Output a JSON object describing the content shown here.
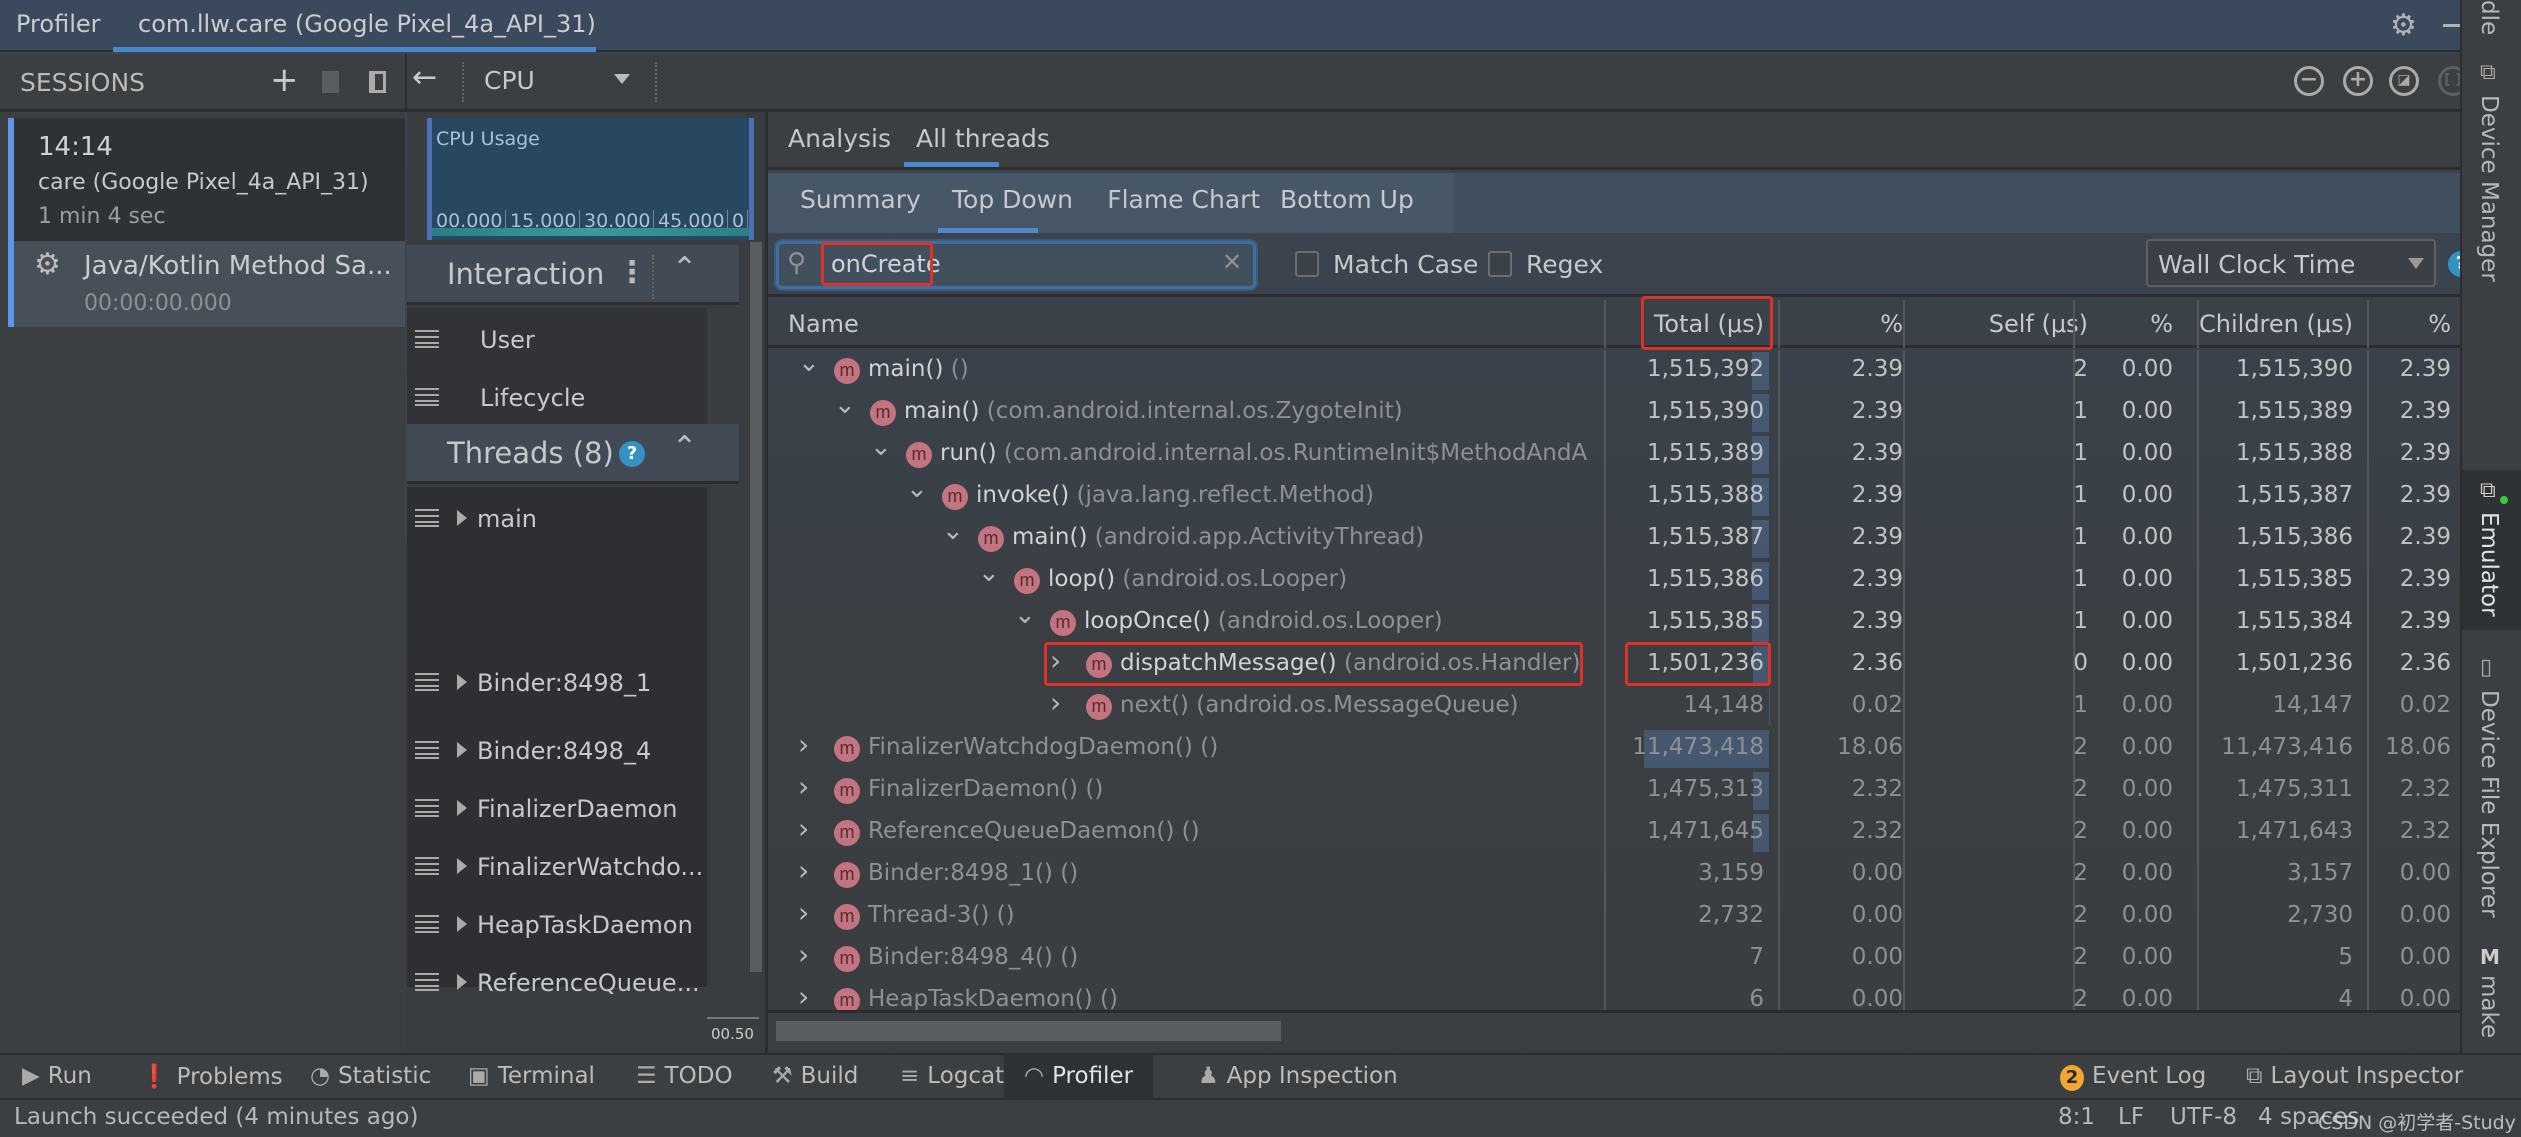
{
  "title_bar": {
    "tool_name": "Profiler",
    "active_tab": "com.llw.care (Google Pixel_4a_API_31)"
  },
  "sessions": {
    "header": "SESSIONS",
    "session": {
      "time": "14:14",
      "device": "care (Google Pixel_4a_API_31)",
      "duration": "1 min 4 sec"
    },
    "recording": {
      "label": "Java/Kotlin Method Sa...",
      "elapsed": "00:00:00.000"
    }
  },
  "profiler_toolbar": {
    "profiler_select": "CPU"
  },
  "cpu_usage": {
    "label": "CPU Usage",
    "ticks": [
      "00.000",
      "15.000",
      "30.000",
      "45.000",
      "0"
    ]
  },
  "interaction": {
    "header": "Interaction",
    "tracks": [
      "User",
      "Lifecycle"
    ]
  },
  "threads": {
    "header": "Threads (8)",
    "items": [
      "main",
      "Binder:8498_1",
      "Binder:8498_4",
      "FinalizerDaemon",
      "FinalizerWatchdo...",
      "HeapTaskDaemon",
      "ReferenceQueue..."
    ],
    "ruler_label": "00.50"
  },
  "analysis_tabs": [
    "Analysis",
    "All threads"
  ],
  "active_analysis_tab": "All threads",
  "sub_tabs": [
    "Summary",
    "Top Down",
    "Flame Chart",
    "Bottom Up"
  ],
  "active_sub_tab": "Top Down",
  "search": {
    "value": "onCreate",
    "match_case": "Match Case",
    "regex": "Regex",
    "match_case_checked": false,
    "regex_checked": false
  },
  "clock_select": "Wall Clock Time",
  "table": {
    "columns": [
      "Name",
      "Total (μs)",
      "%",
      "Self (μs)",
      "%",
      "Children (μs)",
      "%"
    ],
    "rows": [
      {
        "depth": 0,
        "expanded": true,
        "name": "main()",
        "pkg": "()",
        "total": "1,515,392",
        "total_pct": "2.39",
        "self": "2",
        "self_pct": "0.00",
        "children": "1,515,390",
        "children_pct": "2.39",
        "dim": false
      },
      {
        "depth": 1,
        "expanded": true,
        "name": "main()",
        "pkg": "(com.android.internal.os.ZygoteInit)",
        "total": "1,515,390",
        "total_pct": "2.39",
        "self": "1",
        "self_pct": "0.00",
        "children": "1,515,389",
        "children_pct": "2.39",
        "dim": false
      },
      {
        "depth": 2,
        "expanded": true,
        "name": "run()",
        "pkg": "(com.android.internal.os.RuntimeInit$MethodAndA",
        "total": "1,515,389",
        "total_pct": "2.39",
        "self": "1",
        "self_pct": "0.00",
        "children": "1,515,388",
        "children_pct": "2.39",
        "dim": false
      },
      {
        "depth": 3,
        "expanded": true,
        "name": "invoke()",
        "pkg": "(java.lang.reflect.Method)",
        "total": "1,515,388",
        "total_pct": "2.39",
        "self": "1",
        "self_pct": "0.00",
        "children": "1,515,387",
        "children_pct": "2.39",
        "dim": false
      },
      {
        "depth": 4,
        "expanded": true,
        "name": "main()",
        "pkg": "(android.app.ActivityThread)",
        "total": "1,515,387",
        "total_pct": "2.39",
        "self": "1",
        "self_pct": "0.00",
        "children": "1,515,386",
        "children_pct": "2.39",
        "dim": false
      },
      {
        "depth": 5,
        "expanded": true,
        "name": "loop()",
        "pkg": "(android.os.Looper)",
        "total": "1,515,386",
        "total_pct": "2.39",
        "self": "1",
        "self_pct": "0.00",
        "children": "1,515,385",
        "children_pct": "2.39",
        "dim": false
      },
      {
        "depth": 6,
        "expanded": true,
        "name": "loopOnce()",
        "pkg": "(android.os.Looper)",
        "total": "1,515,385",
        "total_pct": "2.39",
        "self": "1",
        "self_pct": "0.00",
        "children": "1,515,384",
        "children_pct": "2.39",
        "dim": false
      },
      {
        "depth": 7,
        "expanded": false,
        "name": "dispatchMessage()",
        "pkg": "(android.os.Handler)",
        "total": "1,501,236",
        "total_pct": "2.36",
        "self": "0",
        "self_pct": "0.00",
        "children": "1,501,236",
        "children_pct": "2.36",
        "dim": false,
        "highlighted": true
      },
      {
        "depth": 7,
        "expanded": false,
        "name": "next()",
        "pkg": "(android.os.MessageQueue)",
        "total": "14,148",
        "total_pct": "0.02",
        "self": "1",
        "self_pct": "0.00",
        "children": "14,147",
        "children_pct": "0.02",
        "dim": true
      },
      {
        "depth": 0,
        "expanded": false,
        "name": "FinalizerWatchdogDaemon()",
        "pkg": "()",
        "total": "11,473,418",
        "total_pct": "18.06",
        "self": "2",
        "self_pct": "0.00",
        "children": "11,473,416",
        "children_pct": "18.06",
        "dim": true
      },
      {
        "depth": 0,
        "expanded": false,
        "name": "FinalizerDaemon()",
        "pkg": "()",
        "total": "1,475,313",
        "total_pct": "2.32",
        "self": "2",
        "self_pct": "0.00",
        "children": "1,475,311",
        "children_pct": "2.32",
        "dim": true
      },
      {
        "depth": 0,
        "expanded": false,
        "name": "ReferenceQueueDaemon()",
        "pkg": "()",
        "total": "1,471,645",
        "total_pct": "2.32",
        "self": "2",
        "self_pct": "0.00",
        "children": "1,471,643",
        "children_pct": "2.32",
        "dim": true
      },
      {
        "depth": 0,
        "expanded": false,
        "name": "Binder:8498_1()",
        "pkg": "()",
        "total": "3,159",
        "total_pct": "0.00",
        "self": "2",
        "self_pct": "0.00",
        "children": "3,157",
        "children_pct": "0.00",
        "dim": true
      },
      {
        "depth": 0,
        "expanded": false,
        "name": "Thread-3()",
        "pkg": "()",
        "total": "2,732",
        "total_pct": "0.00",
        "self": "2",
        "self_pct": "0.00",
        "children": "2,730",
        "children_pct": "0.00",
        "dim": true
      },
      {
        "depth": 0,
        "expanded": false,
        "name": "Binder:8498_4()",
        "pkg": "()",
        "total": "7",
        "total_pct": "0.00",
        "self": "2",
        "self_pct": "0.00",
        "children": "5",
        "children_pct": "0.00",
        "dim": true
      },
      {
        "depth": 0,
        "expanded": false,
        "name": "HeapTaskDaemon()",
        "pkg": "()",
        "total": "6",
        "total_pct": "0.00",
        "self": "2",
        "self_pct": "0.00",
        "children": "4",
        "children_pct": "0.00",
        "dim": true
      }
    ]
  },
  "right_sidebar": [
    "dle",
    "Device Manager",
    "Emulator",
    "Device File Explorer",
    "make"
  ],
  "tool_windows": [
    "Run",
    "Problems",
    "Statistic",
    "Terminal",
    "TODO",
    "Build",
    "Logcat",
    "Profiler",
    "App Inspection"
  ],
  "active_tool_window": "Profiler",
  "right_tool_windows": {
    "event_log": "Event Log",
    "event_log_count": "2",
    "layout_inspector": "Layout Inspector"
  },
  "status_bar": {
    "message": "Launch succeeded (4 minutes ago)",
    "position": "8:1",
    "line_sep": "LF",
    "encoding": "UTF-8",
    "indent": "4 spaces",
    "watermark": "CSDN @初学者-Study"
  },
  "colors": {
    "accent": "#4a88c7",
    "method_icon": "#c27580",
    "highlight_box": "#e0302a",
    "help": "#3592c4",
    "event_badge": "#f0a732"
  }
}
